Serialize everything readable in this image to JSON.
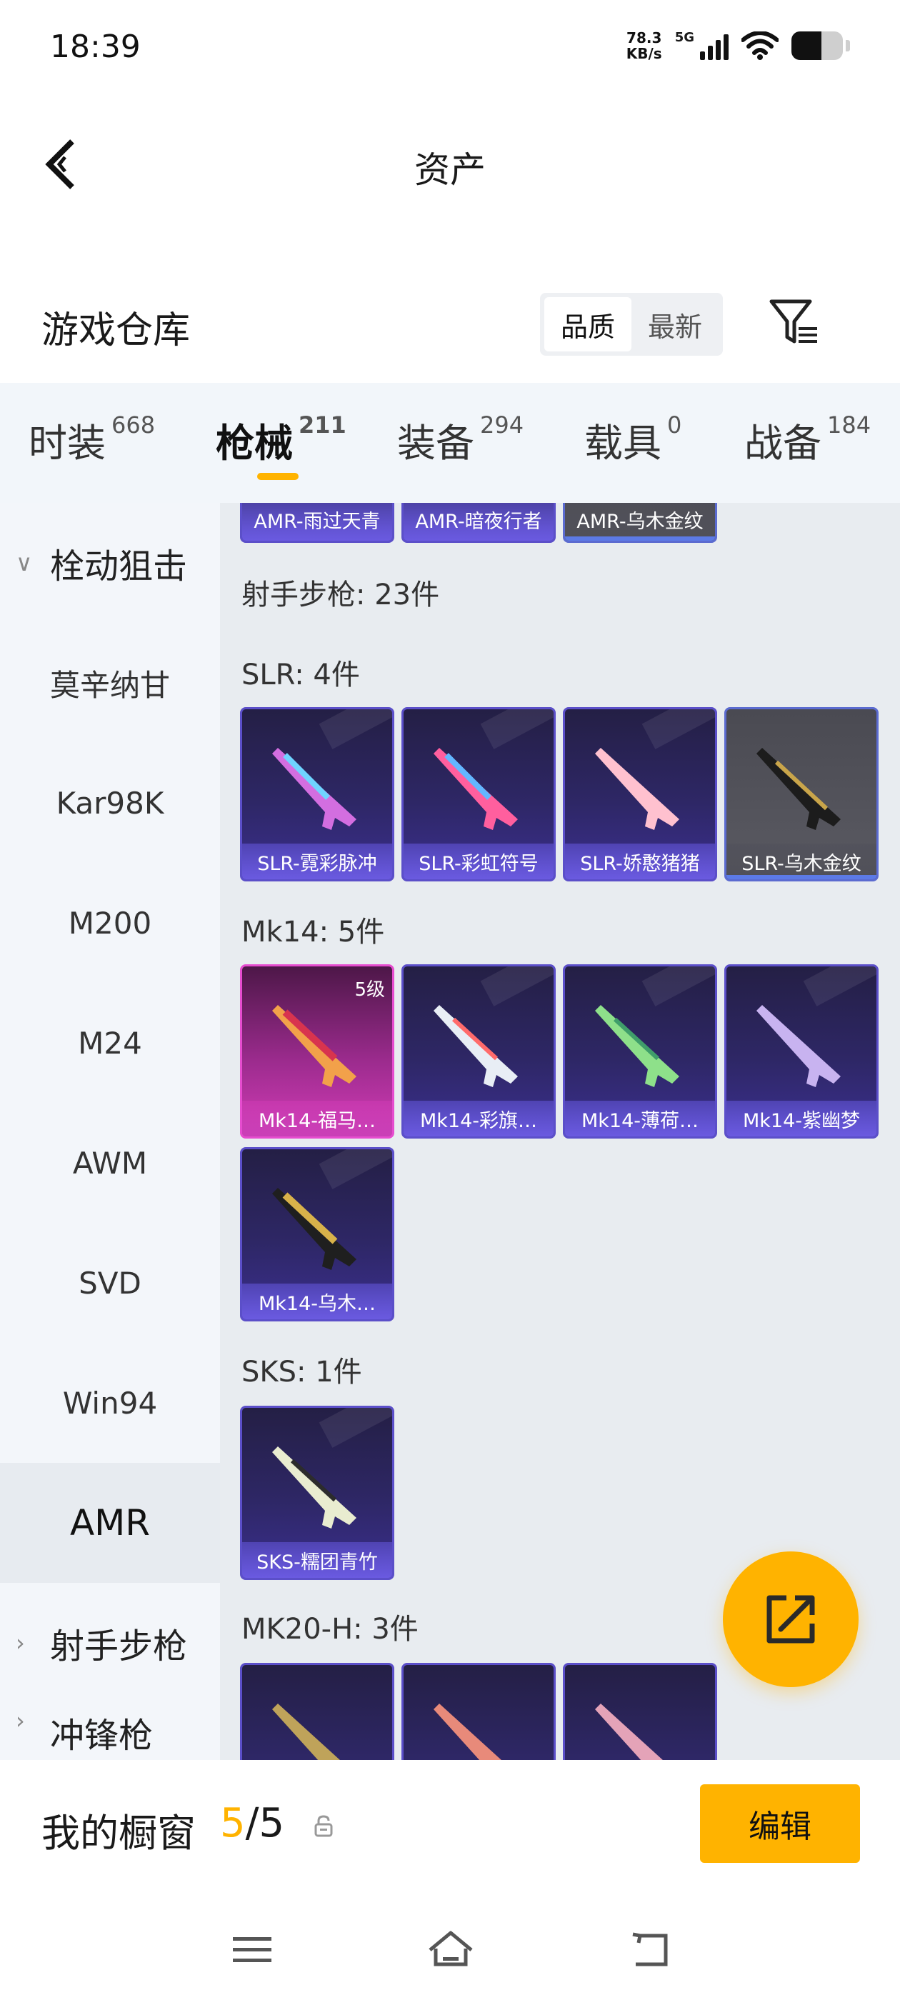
{
  "status": {
    "time": "18:39",
    "net_speed_value": "78.3",
    "net_speed_unit": "KB/s",
    "network": "5G"
  },
  "nav": {
    "title": "资产"
  },
  "warehouse": {
    "title": "游戏仓库",
    "sort_options": [
      "品质",
      "最新"
    ],
    "sort_active": "品质"
  },
  "tabs": [
    {
      "label": "时装",
      "count": "668"
    },
    {
      "label": "枪械",
      "count": "211"
    },
    {
      "label": "装备",
      "count": "294"
    },
    {
      "label": "载具",
      "count": "0"
    },
    {
      "label": "战备",
      "count": "184"
    }
  ],
  "sidebar": {
    "group_bolt": "栓动狙击",
    "items": [
      "莫辛纳甘",
      "Kar98K",
      "M200",
      "M24",
      "AWM",
      "SVD",
      "Win94",
      "AMR"
    ],
    "active_item": "AMR",
    "group_dmr": "射手步枪",
    "group_partial": "冲锋枪"
  },
  "content": {
    "amr_cards": [
      "AMR-雨过天青",
      "AMR-暗夜行者",
      "AMR-乌木金纹"
    ],
    "dmr_summary": "射手步枪: 23件",
    "slr_label": "SLR: 4件",
    "slr_cards": [
      "SLR-霓彩脉冲",
      "SLR-彩虹符号",
      "SLR-娇憨猪猪",
      "SLR-乌木金纹"
    ],
    "mk14_label": "Mk14: 5件",
    "mk14_level": "5级",
    "mk14_cards": [
      "Mk14-福马…",
      "Mk14-彩旗…",
      "Mk14-薄荷…",
      "Mk14-紫幽梦",
      "Mk14-乌木…"
    ],
    "sks_label": "SKS: 1件",
    "sks_cards": [
      "SKS-糯团青竹"
    ],
    "mk20_label": "MK20-H: 3件"
  },
  "showcase": {
    "label": "我的橱窗",
    "current": "5",
    "separator": "/",
    "total": "5",
    "edit_label": "编辑"
  },
  "colors": {
    "accent": "#ffb300",
    "card_purple": "#5b4fc9",
    "card_pink": "#d23cb6"
  }
}
